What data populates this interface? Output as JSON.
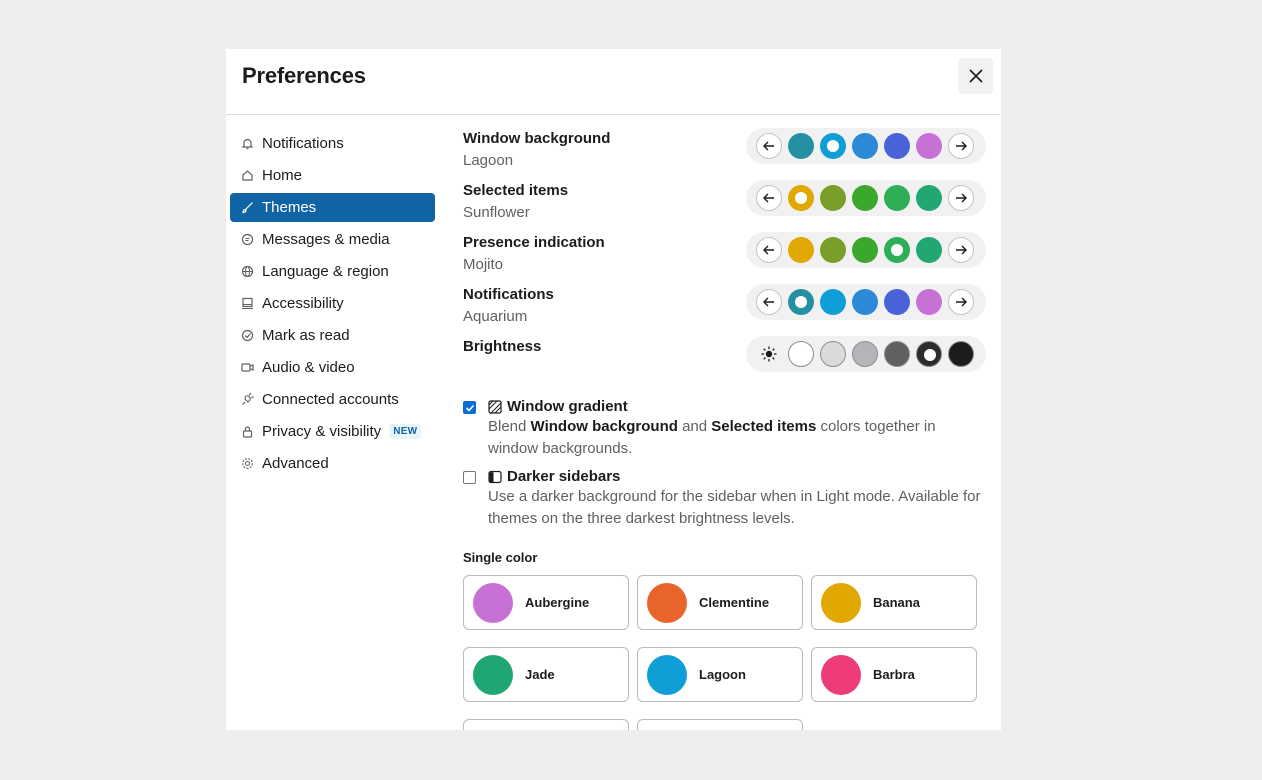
{
  "modal": {
    "title": "Preferences"
  },
  "sidebar": {
    "items": [
      {
        "label": "Notifications",
        "icon": "bell-icon"
      },
      {
        "label": "Home",
        "icon": "home-icon"
      },
      {
        "label": "Themes",
        "icon": "brush-icon",
        "active": true
      },
      {
        "label": "Messages & media",
        "icon": "message-icon"
      },
      {
        "label": "Language & region",
        "icon": "globe-icon"
      },
      {
        "label": "Accessibility",
        "icon": "monitor-icon"
      },
      {
        "label": "Mark as read",
        "icon": "check-circle-icon"
      },
      {
        "label": "Audio & video",
        "icon": "video-icon"
      },
      {
        "label": "Connected accounts",
        "icon": "plug-icon"
      },
      {
        "label": "Privacy & visibility",
        "icon": "lock-icon",
        "badge": "NEW"
      },
      {
        "label": "Advanced",
        "icon": "gear-icon"
      }
    ]
  },
  "themes": {
    "rows": [
      {
        "label": "Window background",
        "value": "Lagoon",
        "colors": [
          "#2590a2",
          "#0f9fd6",
          "#2b89d8",
          "#4a62d8",
          "#c771d6"
        ],
        "selected": 1
      },
      {
        "label": "Selected items",
        "value": "Sunflower",
        "colors": [
          "#e0a800",
          "#7a9e2a",
          "#3ba82d",
          "#2fae58",
          "#22a773"
        ],
        "selected": 0
      },
      {
        "label": "Presence indication",
        "value": "Mojito",
        "colors": [
          "#e0a800",
          "#7a9e2a",
          "#3ba82d",
          "#2fae58",
          "#22a773"
        ],
        "selected": 3
      },
      {
        "label": "Notifications",
        "value": "Aquarium",
        "colors": [
          "#2590a2",
          "#0f9fd6",
          "#2b89d8",
          "#4a62d8",
          "#c771d6"
        ],
        "selected": 0
      }
    ],
    "brightness": {
      "label": "Brightness",
      "colors": [
        "#ffffff",
        "#dadadd",
        "#b5b4b8",
        "#616061",
        "#2d2c2d",
        "#1d1c1d"
      ],
      "selected": 4
    },
    "window_gradient": {
      "title": "Window gradient",
      "checked": true,
      "desc_1": "Blend ",
      "desc_bold_1": "Window background",
      "desc_2": " and ",
      "desc_bold_2": "Selected items",
      "desc_3": " colors together in window backgrounds."
    },
    "darker_sidebars": {
      "title": "Darker sidebars",
      "checked": false,
      "desc": "Use a darker background for the sidebar when in Light mode. Available for themes on the three darkest brightness levels."
    },
    "single_color": {
      "title": "Single color",
      "cards": [
        {
          "name": "Aubergine",
          "color": "#c771d6"
        },
        {
          "name": "Clementine",
          "color": "#e8642a"
        },
        {
          "name": "Banana",
          "color": "#e0a800"
        },
        {
          "name": "Jade",
          "color": "#1fa673"
        },
        {
          "name": "Lagoon",
          "color": "#0f9fd6"
        },
        {
          "name": "Barbra",
          "color": "#ed3c76"
        }
      ]
    }
  }
}
